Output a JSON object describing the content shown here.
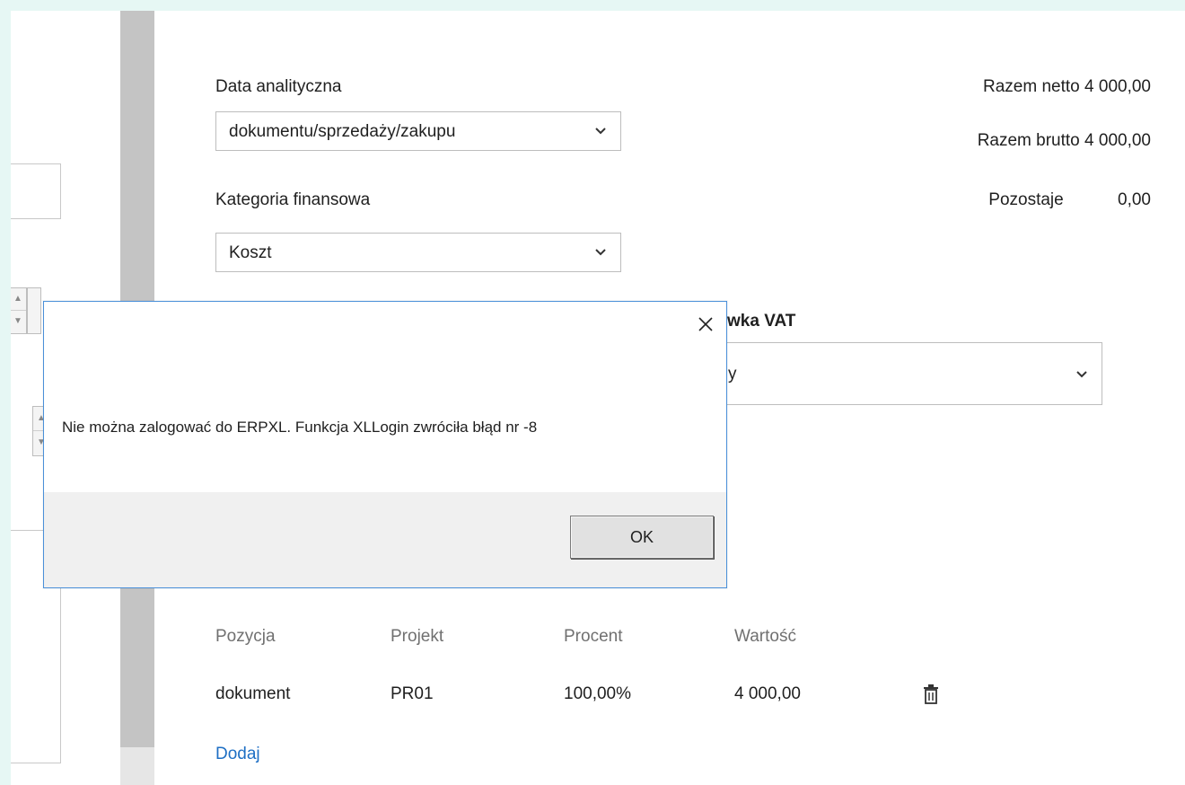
{
  "form": {
    "data_analityczna_label": "Data analityczna",
    "data_analityczna_value": "dokumentu/sprzedaży/zakupu",
    "kategoria_label": "Kategoria finansowa",
    "kategoria_value": "Koszt",
    "stawka_vat_label_partial": "wka VAT",
    "stawka_vat_value_partial": "y"
  },
  "totals": {
    "netto_label": "Razem netto",
    "netto_value": "4 000,00",
    "brutto_label": "Razem brutto",
    "brutto_value": "4 000,00",
    "pozostaje_label": "Pozostaje",
    "pozostaje_value": "0,00"
  },
  "table": {
    "headers": [
      "Pozycja",
      "Projekt",
      "Procent",
      "Wartość"
    ],
    "rows": [
      [
        "dokument",
        "PR01",
        "100,00%",
        "4 000,00"
      ]
    ],
    "add_link": "Dodaj"
  },
  "dialog": {
    "message": "Nie można zalogować do ERPXL. Funkcja XLLogin zwróciła błąd nr -8",
    "ok_label": "OK"
  },
  "icons": {
    "dropdown": "chevron-down-icon",
    "delete": "trash-icon",
    "close": "close-icon",
    "spin_up": "chevron-up-icon",
    "spin_down": "chevron-down-icon"
  },
  "colors": {
    "background": "#e6f7f4",
    "link": "#1e6fc4",
    "dialog_border": "#4a90d9",
    "divider": "#c4c4c4"
  }
}
